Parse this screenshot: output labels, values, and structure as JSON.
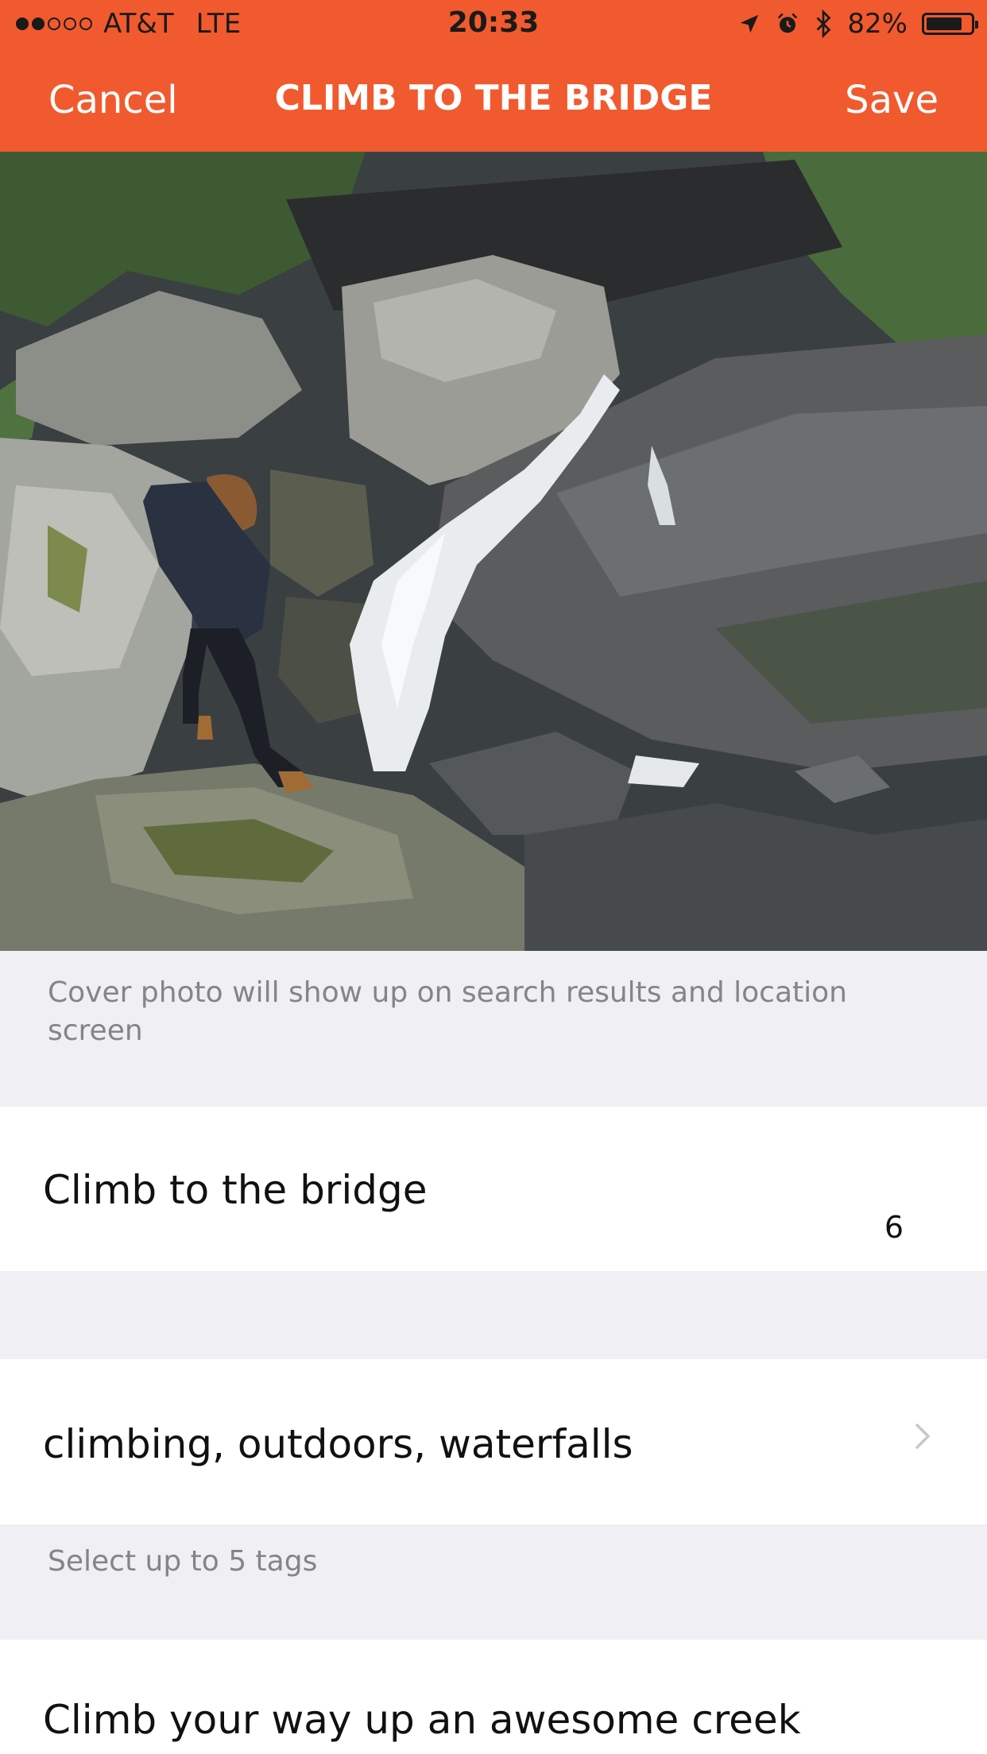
{
  "status_bar": {
    "carrier": "AT&T",
    "network": "LTE",
    "time": "20:33",
    "battery": "82%",
    "battery_level": 0.82,
    "signal_bars_filled": 2,
    "signal_bars_total": 5,
    "icons": [
      "location-arrow-icon",
      "alarm-clock-icon",
      "bluetooth-icon",
      "battery-icon"
    ]
  },
  "nav": {
    "cancel_label": "Cancel",
    "title": "CLIMB TO THE BRIDGE",
    "save_label": "Save"
  },
  "cover_photo": {
    "caption": "Cover photo will show up on search results and location screen"
  },
  "title_field": {
    "value": "Climb to the bridge",
    "char_count": "6"
  },
  "tags_field": {
    "value": "climbing, outdoors, waterfalls",
    "helper": "Select up to 5 tags",
    "icon": "chevron-right-icon"
  },
  "description_field": {
    "value": "Climb your way up an awesome creek"
  },
  "colors": {
    "accent": "#f15a2e",
    "background": "#efeff4",
    "cell": "#ffffff",
    "helper_text": "#858585"
  }
}
